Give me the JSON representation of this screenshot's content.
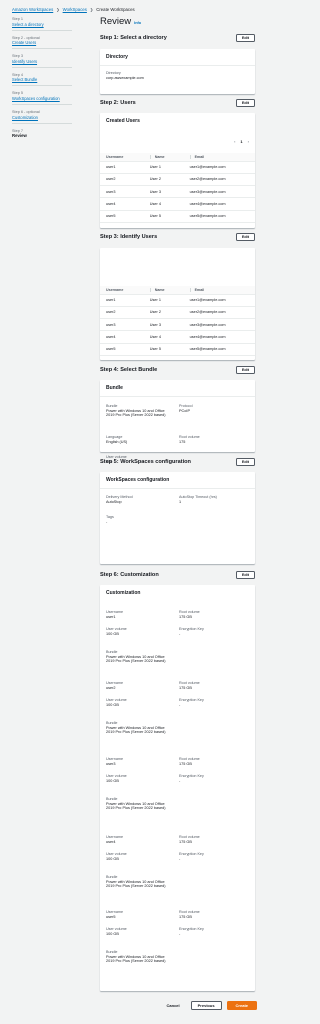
{
  "breadcrumb": [
    "Amazon WorkSpaces",
    "WorkSpaces",
    "Create WorkSpaces"
  ],
  "sidebar": {
    "steps": [
      {
        "num": "Step 1",
        "label": "Select a directory"
      },
      {
        "num": "Step 2 - optional",
        "label": "Create Users"
      },
      {
        "num": "Step 3",
        "label": "Identify Users"
      },
      {
        "num": "Step 4",
        "label": "Select Bundle"
      },
      {
        "num": "Step 5",
        "label": "WorkSpaces configuration"
      },
      {
        "num": "Step 6 - optional",
        "label": "Customization"
      },
      {
        "num": "Step 7",
        "label": "Review"
      }
    ]
  },
  "page": {
    "title": "Review",
    "info": "Info"
  },
  "edit_label": "Edit",
  "step1": {
    "header": "Step 1: Select a directory",
    "panel_title": "Directory",
    "directory_label": "Directory",
    "directory_value": "corp.awsexample.com"
  },
  "step2": {
    "header": "Step 2: Users",
    "panel_title": "Created Users",
    "page_num": "1",
    "columns": [
      "Username",
      "Name",
      "Email"
    ],
    "rows": [
      [
        "user1",
        "User 1",
        "user1@example.com"
      ],
      [
        "user2",
        "User 2",
        "user2@example.com"
      ],
      [
        "user3",
        "User 3",
        "user3@example.com"
      ],
      [
        "user4",
        "User 4",
        "user4@example.com"
      ],
      [
        "user5",
        "User 5",
        "user5@example.com"
      ]
    ]
  },
  "step3": {
    "header": "Step 3: Identify Users",
    "columns": [
      "Username",
      "Name",
      "Email"
    ],
    "rows": [
      [
        "user1",
        "User 1",
        "user1@example.com"
      ],
      [
        "user2",
        "User 2",
        "user2@example.com"
      ],
      [
        "user3",
        "User 3",
        "user3@example.com"
      ],
      [
        "user4",
        "User 4",
        "user4@example.com"
      ],
      [
        "user5",
        "User 5",
        "user5@example.com"
      ]
    ]
  },
  "step4": {
    "header": "Step 4: Select Bundle",
    "panel_title": "Bundle",
    "bundle_label": "Bundle",
    "bundle_value": "Power with Windows 10 and Office 2019 Pro Plus (Server 2022 based)",
    "protocol_label": "Protocol",
    "protocol_value": "PCoIP",
    "language_label": "Language",
    "language_value": "English (US)",
    "root_label": "Root volume",
    "root_value": "175",
    "user_vol_label": "User volume",
    "user_vol_value": "100"
  },
  "step5": {
    "header": "Step 5: WorkSpaces configuration",
    "panel_title": "WorkSpaces configuration",
    "delivery_label": "Delivery Method",
    "delivery_value": "AutoStop",
    "timeout_label": "AutoStop Timeout (hrs)",
    "timeout_value": "1",
    "tags_label": "Tags",
    "tags_value": "-"
  },
  "step6": {
    "header": "Step 6: Customization",
    "panel_title": "Customization",
    "labels": {
      "username": "Username",
      "root": "Root volume",
      "user_vol": "User volume",
      "encryption": "Encryption Key",
      "bundle": "Bundle"
    },
    "items": [
      {
        "username": "user1",
        "root": "175 GB",
        "user_vol": "100 GB",
        "encryption": "-",
        "bundle": "Power with Windows 10 and Office 2019 Pro Plus (Server 2022 based)"
      },
      {
        "username": "user2",
        "root": "175 GB",
        "user_vol": "100 GB",
        "encryption": "-",
        "bundle": "Power with Windows 10 and Office 2019 Pro Plus (Server 2022 based)"
      },
      {
        "username": "user3",
        "root": "175 GB",
        "user_vol": "100 GB",
        "encryption": "-",
        "bundle": "Power with Windows 10 and Office 2019 Pro Plus (Server 2022 based)"
      },
      {
        "username": "user4",
        "root": "175 GB",
        "user_vol": "100 GB",
        "encryption": "-",
        "bundle": "Power with Windows 10 and Office 2019 Pro Plus (Server 2022 based)"
      },
      {
        "username": "user5",
        "root": "175 GB",
        "user_vol": "100 GB",
        "encryption": "-",
        "bundle": "Power with Windows 10 and Office 2019 Pro Plus (Server 2022 based)"
      }
    ]
  },
  "footer": {
    "cancel": "Cancel",
    "previous": "Previous",
    "create": "Create"
  }
}
